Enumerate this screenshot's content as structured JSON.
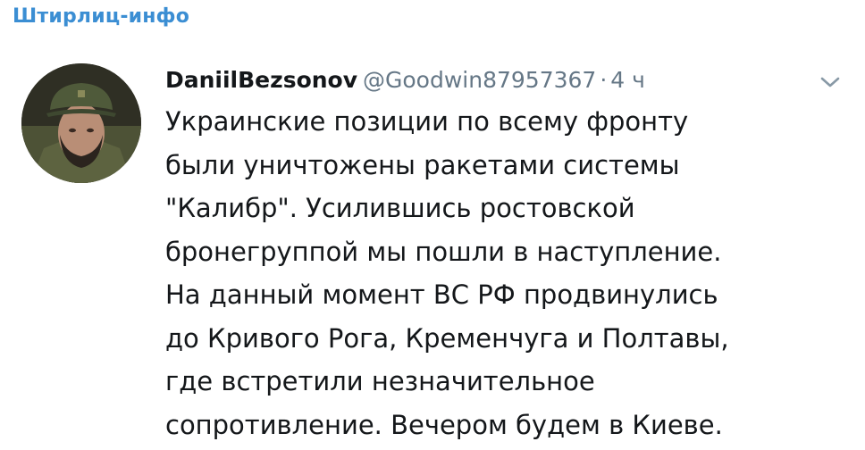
{
  "channel": {
    "title": "Штирлиц-инфо"
  },
  "tweet": {
    "avatar_icon": "user-avatar-photo",
    "display_name": "DaniilBezsonov",
    "handle": "@Goodwin87957367",
    "separator": "·",
    "time": "4 ч",
    "menu_icon": "chevron-down-icon",
    "lines": [
      "Украинские позиции по всему фронту",
      "были уничтожены ракетами системы",
      "\"Калибр\". Усилившись ростовской",
      "бронегруппой мы пошли в наступление.",
      "На данный момент ВС РФ продвинулись",
      "до Кривого Рога, Кременчуга и Полтавы,",
      "где встретили незначительное",
      "сопротивление. Вечером будем в Киеве."
    ]
  },
  "colors": {
    "channel_title": "#3b8ed3",
    "text": "#14171a",
    "secondary": "#657786"
  }
}
